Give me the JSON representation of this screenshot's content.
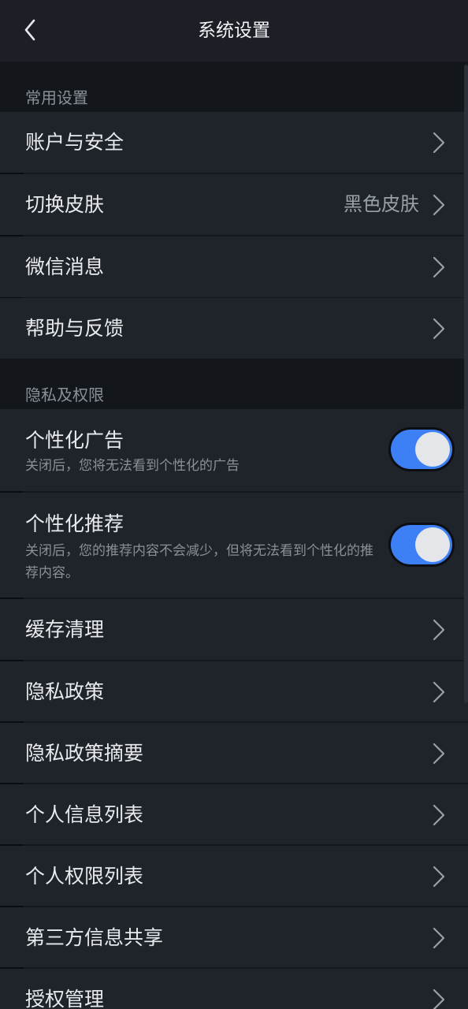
{
  "header": {
    "back_icon": "chevron-left-icon",
    "title": "系统设置"
  },
  "sections": {
    "common": {
      "title": "常用设置",
      "items": [
        {
          "label": "账户与安全",
          "value": ""
        },
        {
          "label": "切换皮肤",
          "value": "黑色皮肤"
        },
        {
          "label": "微信消息",
          "value": ""
        },
        {
          "label": "帮助与反馈",
          "value": ""
        }
      ]
    },
    "privacy": {
      "title": "隐私及权限",
      "toggles": [
        {
          "label": "个性化广告",
          "desc": "关闭后，您将无法看到个性化的广告",
          "on": true
        },
        {
          "label": "个性化推荐",
          "desc": "关闭后，您的推荐内容不会减少，但将无法看到个性化的推荐内容。",
          "on": true
        }
      ],
      "items": [
        {
          "label": "缓存清理"
        },
        {
          "label": "隐私政策"
        },
        {
          "label": "隐私政策摘要"
        },
        {
          "label": "个人信息列表"
        },
        {
          "label": "个人权限列表"
        },
        {
          "label": "第三方信息共享"
        },
        {
          "label": "授权管理"
        }
      ]
    }
  },
  "colors": {
    "background": "#13161b",
    "row_background": "#1f232a",
    "header_background": "#1c1f26",
    "toggle_on": "#3d80f5",
    "secondary_text": "#8a8f98"
  }
}
